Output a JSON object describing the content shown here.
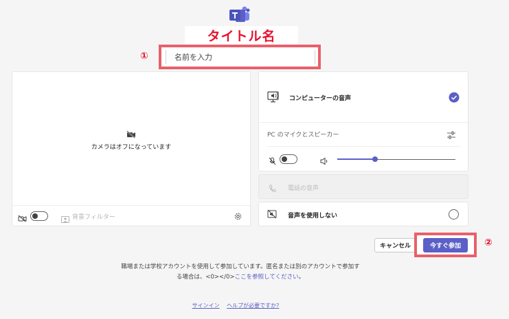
{
  "app": {
    "title_annotation": "タイトル名"
  },
  "markers": {
    "one": "①",
    "two": "②"
  },
  "name_input": {
    "placeholder": "名前を入力",
    "value": ""
  },
  "video": {
    "camera_off_text": "カメラはオフになっています",
    "background_filter_label": "背景フィルター",
    "camera_toggle": "off"
  },
  "audio": {
    "computer_audio_label": "コンピューターの音声",
    "computer_audio_selected": true,
    "device_label": "PC のマイクとスピーカー",
    "mic_toggle": "off",
    "volume_level": 0.32,
    "phone_audio_label": "電話の音声",
    "no_audio_label": "音声を使用しない"
  },
  "buttons": {
    "cancel": "キャンセル",
    "join_now": "今すぐ参加"
  },
  "notice": {
    "line1": "職場または学校アカウントを使用して参加しています。匿名または別のアカウントで参加す",
    "line2_prefix": "る場合は、<0></0>",
    "line2_link": "ここを参照してください",
    "line2_suffix": "。"
  },
  "footer": {
    "sign_in": "サインイン",
    "help": "ヘルプが必要ですか?"
  },
  "colors": {
    "accent": "#5b5fc7",
    "annotation_red": "#e8112d",
    "highlight_border": "#e8606a"
  },
  "icons": {
    "logo": "teams-logo-icon",
    "camera_off": "video-off-icon",
    "computer": "computer-speaker-icon",
    "check": "check-circle-icon",
    "tune": "options-icon",
    "mic_off": "mic-off-icon",
    "speaker": "speaker-icon",
    "phone": "phone-icon",
    "no_audio": "speaker-off-icon",
    "settings": "gear-icon",
    "bg_filter": "background-filter-icon"
  }
}
